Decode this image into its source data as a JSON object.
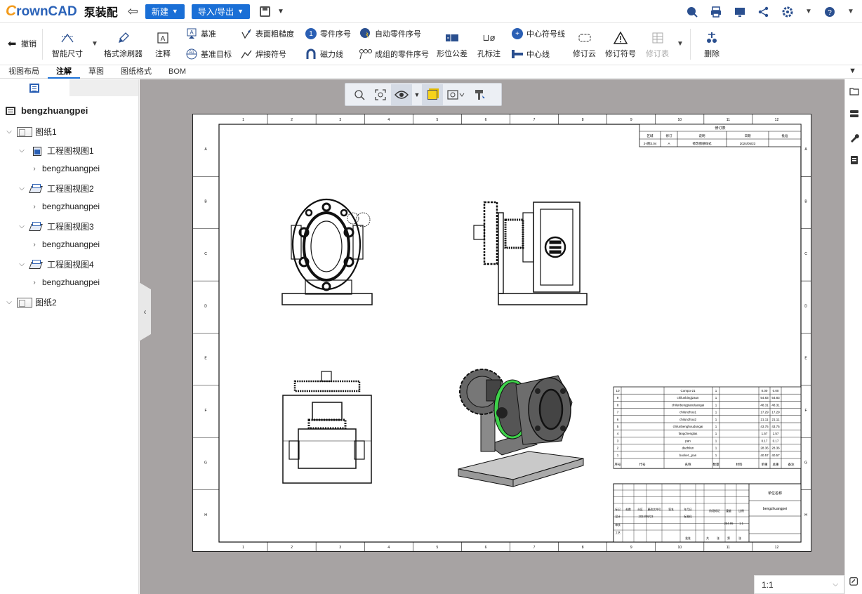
{
  "app": {
    "logo_c": "C",
    "logo_rest": "rownCAD",
    "doc_title": "泵装配"
  },
  "header": {
    "new_label": "新建",
    "import_export_label": "导入/导出",
    "right_icons": [
      "search-icon",
      "print-icon",
      "screen-icon",
      "share-icon",
      "settings-icon",
      "help-icon"
    ]
  },
  "ribbon": {
    "undo": "撤销",
    "smart_dim": "智能尺寸",
    "format_painter": "格式涂刷器",
    "note": "注释",
    "datum": "基准",
    "datum_target": "基准目标",
    "surface_finish": "表面粗糙度",
    "weld_symbol": "焊接符号",
    "balloon": "零件序号",
    "magnetic_line": "磁力线",
    "auto_balloon": "自动零件序号",
    "stacked_balloon": "成组的零件序号",
    "gtol": "形位公差",
    "hole_callout": "孔标注",
    "center_mark": "中心符号线",
    "centerline": "中心线",
    "revision_cloud": "修订云",
    "revision_symbol": "修订符号",
    "revision_table": "修订表",
    "delete": "删除"
  },
  "tabs": [
    "视图布局",
    "注解",
    "草图",
    "图纸格式",
    "BOM"
  ],
  "active_tab": "注解",
  "tree": {
    "root": "bengzhuangpei",
    "sheet1": "图纸1",
    "views": [
      {
        "label": "工程图视图1",
        "child": "bengzhuangpei"
      },
      {
        "label": "工程图视图2",
        "child": "bengzhuangpei"
      },
      {
        "label": "工程图视图3",
        "child": "bengzhuangpei"
      },
      {
        "label": "工程图视图4",
        "child": "bengzhuangpei"
      }
    ],
    "sheet2": "图纸2"
  },
  "scale": {
    "value": "1:1"
  },
  "sheet": {
    "col_labels": [
      "1",
      "2",
      "3",
      "4",
      "5",
      "6",
      "7",
      "8",
      "9",
      "10",
      "11",
      "12"
    ],
    "row_labels": [
      "A",
      "B",
      "C",
      "D",
      "E",
      "F",
      "G",
      "H"
    ],
    "revision_table": {
      "title": "修订表",
      "headers": [
        "区域",
        "修订",
        "说明",
        "日期",
        "批准"
      ],
      "row": [
        "2-I图3.04",
        "A",
        "修改图纸样式",
        "2024/05/23",
        ""
      ]
    },
    "bom": {
      "rows": [
        {
          "no": "10",
          "name": "Compo-21",
          "qty": "1",
          "w1": "0.00",
          "w2": "0.00"
        },
        {
          "no": "9",
          "name": "chilunbingjzaun",
          "qty": "1",
          "w1": "54.83",
          "w2": "54.83"
        },
        {
          "no": "8",
          "name": "chilunbengpianduangai",
          "qty": "1",
          "w1": "48.31",
          "w2": "48.31"
        },
        {
          "no": "7",
          "name": "chilunzhou1",
          "qty": "1",
          "w1": "17.29",
          "w2": "17.29"
        },
        {
          "no": "6",
          "name": "chilunzhou2",
          "qty": "1",
          "w1": "21.11",
          "w2": "21.11"
        },
        {
          "no": "5",
          "name": "chilunbenghoudungai",
          "qty": "1",
          "w1": "43.75",
          "w2": "43.75"
        },
        {
          "no": "4",
          "name": "fangchenglas",
          "qty": "1",
          "w1": "1.57",
          "w2": "1.57"
        },
        {
          "no": "3",
          "name": "pan",
          "qty": "1",
          "w1": "0.17",
          "w2": "0.17"
        },
        {
          "no": "2",
          "name": "dachilun",
          "qty": "1",
          "w1": "28.36",
          "w2": "28.36"
        },
        {
          "no": "1",
          "name": "bucket _pan",
          "qty": "1",
          "w1": "40.57",
          "w2": "40.57"
        }
      ],
      "headers": [
        "序号",
        "代号",
        "名称",
        "数量",
        "材料",
        "单重",
        "总重",
        "备注"
      ]
    },
    "title_block": {
      "company": "单位名称",
      "drawing_name": "bengzhuangpei",
      "date": "2024/05/23",
      "mass": "254.95",
      "scale": "1:1",
      "labels": [
        "标记",
        "处数",
        "分区",
        "更改文件号",
        "签名",
        "年月日",
        "设计",
        "标准化",
        "阶段标记",
        "重量",
        "比例",
        "审核",
        "工艺",
        "批准",
        "共",
        "张",
        "第",
        "张"
      ]
    }
  }
}
